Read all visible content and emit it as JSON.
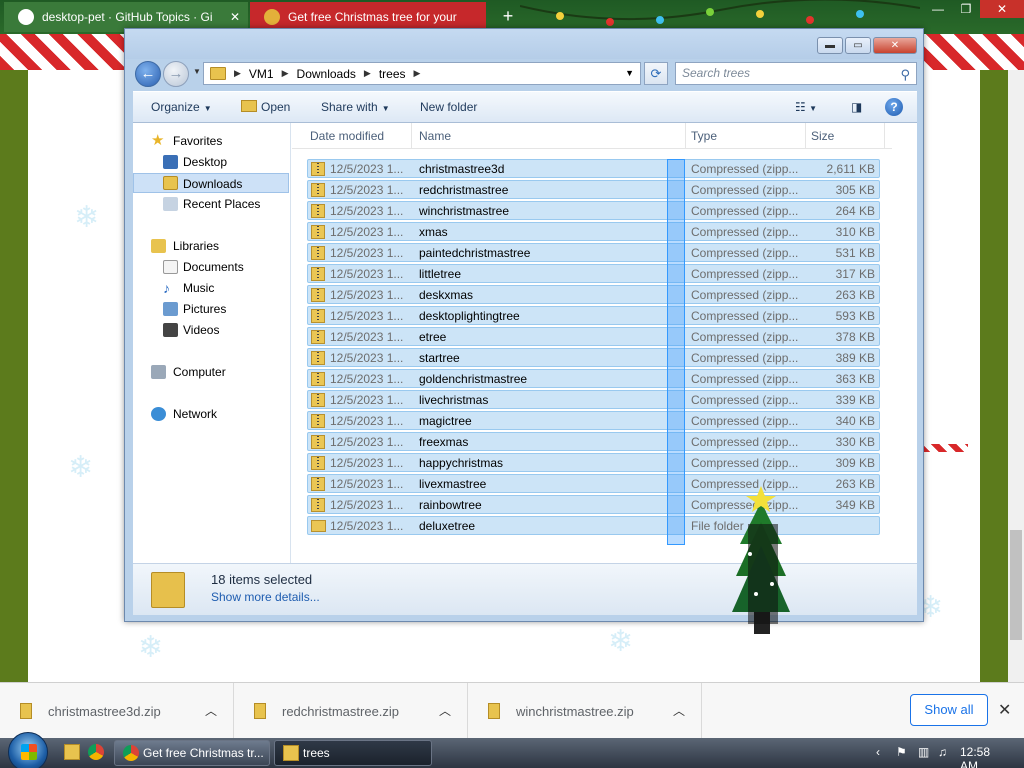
{
  "browser": {
    "tabs": [
      {
        "label": "desktop-pet · GitHub Topics · Gi"
      },
      {
        "label": "Get free Christmas tree for your"
      }
    ],
    "new_tab": "+",
    "window_controls": {
      "min": "—",
      "max": "❐",
      "close": "✕"
    }
  },
  "explorer": {
    "title_buttons": {
      "min": "▬",
      "max": "▭",
      "close": "✕"
    },
    "breadcrumb": [
      "VM1",
      "Downloads",
      "trees"
    ],
    "search_placeholder": "Search trees",
    "commands": {
      "organize": "Organize",
      "open": "Open",
      "share": "Share with",
      "new_folder": "New folder"
    },
    "nav": {
      "favorites": "Favorites",
      "desktop": "Desktop",
      "downloads": "Downloads",
      "recent": "Recent Places",
      "libraries": "Libraries",
      "documents": "Documents",
      "music": "Music",
      "pictures": "Pictures",
      "videos": "Videos",
      "computer": "Computer",
      "network": "Network"
    },
    "columns": {
      "date": "Date modified",
      "name": "Name",
      "type": "Type",
      "size": "Size"
    },
    "files": [
      {
        "date": "12/5/2023 1...",
        "name": "christmastree3d",
        "type": "Compressed (zipp...",
        "size": "2,611 KB"
      },
      {
        "date": "12/5/2023 1...",
        "name": "redchristmastree",
        "type": "Compressed (zipp...",
        "size": "305 KB"
      },
      {
        "date": "12/5/2023 1...",
        "name": "winchristmastree",
        "type": "Compressed (zipp...",
        "size": "264 KB"
      },
      {
        "date": "12/5/2023 1...",
        "name": "xmas",
        "type": "Compressed (zipp...",
        "size": "310 KB"
      },
      {
        "date": "12/5/2023 1...",
        "name": "paintedchristmastree",
        "type": "Compressed (zipp...",
        "size": "531 KB"
      },
      {
        "date": "12/5/2023 1...",
        "name": "littletree",
        "type": "Compressed (zipp...",
        "size": "317 KB"
      },
      {
        "date": "12/5/2023 1...",
        "name": "deskxmas",
        "type": "Compressed (zipp...",
        "size": "263 KB"
      },
      {
        "date": "12/5/2023 1...",
        "name": "desktoplightingtree",
        "type": "Compressed (zipp...",
        "size": "593 KB"
      },
      {
        "date": "12/5/2023 1...",
        "name": "etree",
        "type": "Compressed (zipp...",
        "size": "378 KB"
      },
      {
        "date": "12/5/2023 1...",
        "name": "startree",
        "type": "Compressed (zipp...",
        "size": "389 KB"
      },
      {
        "date": "12/5/2023 1...",
        "name": "goldenchristmastree",
        "type": "Compressed (zipp...",
        "size": "363 KB"
      },
      {
        "date": "12/5/2023 1...",
        "name": "livechristmas",
        "type": "Compressed (zipp...",
        "size": "339 KB"
      },
      {
        "date": "12/5/2023 1...",
        "name": "magictree",
        "type": "Compressed (zipp...",
        "size": "340 KB"
      },
      {
        "date": "12/5/2023 1...",
        "name": "freexmas",
        "type": "Compressed (zipp...",
        "size": "330 KB"
      },
      {
        "date": "12/5/2023 1...",
        "name": "happychristmas",
        "type": "Compressed (zipp...",
        "size": "309 KB"
      },
      {
        "date": "12/5/2023 1...",
        "name": "livexmastree",
        "type": "Compressed (zipp...",
        "size": "263 KB"
      },
      {
        "date": "12/5/2023 1...",
        "name": "rainbowtree",
        "type": "Compressed (zipp...",
        "size": "349 KB"
      },
      {
        "date": "12/5/2023 1...",
        "name": "deluxetree",
        "type": "File folder",
        "size": ""
      }
    ],
    "details": {
      "count": "18 items selected",
      "more": "Show more details..."
    }
  },
  "downloads_bar": {
    "items": [
      "christmastree3d.zip",
      "redchristmastree.zip",
      "winchristmastree.zip"
    ],
    "show_all": "Show all",
    "close": "✕"
  },
  "taskbar": {
    "tasks": [
      "Get free Christmas tr...",
      "trees"
    ],
    "clock": "12:58 AM"
  },
  "colors": {
    "selection": "#cce4f7",
    "selection_border": "#99c9ef",
    "rubber_band": "#3399ff",
    "browser_green": "#2e6b2e",
    "candy_red": "#d8282a"
  }
}
